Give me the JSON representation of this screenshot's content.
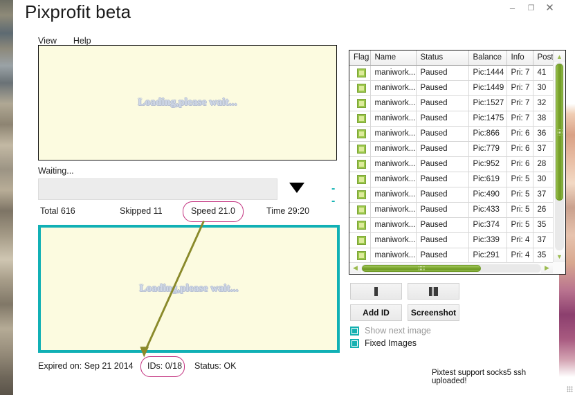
{
  "window": {
    "title": "Pixprofit beta",
    "controls": {
      "minimize": "–",
      "maximize": "❐",
      "close": "✕"
    }
  },
  "menubar": {
    "items": [
      {
        "label": "View"
      },
      {
        "label": "Help"
      }
    ]
  },
  "preview_top": {
    "loading_text": "Loading,please wait..."
  },
  "preview_bottom": {
    "loading_text": "Loading,please wait..."
  },
  "progress": {
    "waiting_label": "Waiting...",
    "value": "",
    "dropdown_icon": "triangle-down-icon",
    "dash_indicator": "--"
  },
  "stats": {
    "total": "Total 616",
    "skipped": "Skipped 11",
    "speed": "Speed 21.0",
    "time": "Time 29:20"
  },
  "footer": {
    "expired": "Expired on: Sep 21 2014",
    "ids": "IDs: 0/18",
    "status": "Status: OK",
    "support_note": "Pixtest support socks5  ssh uploaded!"
  },
  "annotations": {
    "highlight_color": "#c2307e",
    "arrow_color": "#8a8a2b",
    "speed_circled": "Speed 21.0",
    "ids_circled": "IDs: 0/18"
  },
  "accounts_table": {
    "columns": [
      "Flag",
      "Name",
      "Status",
      "Balance",
      "Info",
      "Poste"
    ],
    "rows": [
      {
        "flag": "flag-green-icon",
        "name": "maniwork...",
        "status": "Paused",
        "balance": "Pic:1444",
        "info": "Pri: 7",
        "posted": "41"
      },
      {
        "flag": "flag-green-icon",
        "name": "maniwork...",
        "status": "Paused",
        "balance": "Pic:1449",
        "info": "Pri: 7",
        "posted": "30"
      },
      {
        "flag": "flag-green-icon",
        "name": "maniwork...",
        "status": "Paused",
        "balance": "Pic:1527",
        "info": "Pri: 7",
        "posted": "32"
      },
      {
        "flag": "flag-green-icon",
        "name": "maniwork...",
        "status": "Paused",
        "balance": "Pic:1475",
        "info": "Pri: 7",
        "posted": "38"
      },
      {
        "flag": "flag-green-icon",
        "name": "maniwork...",
        "status": "Paused",
        "balance": "Pic:866",
        "info": "Pri: 6",
        "posted": "36"
      },
      {
        "flag": "flag-green-icon",
        "name": "maniwork...",
        "status": "Paused",
        "balance": "Pic:779",
        "info": "Pri: 6",
        "posted": "37"
      },
      {
        "flag": "flag-green-icon",
        "name": "maniwork...",
        "status": "Paused",
        "balance": "Pic:952",
        "info": "Pri: 6",
        "posted": "28"
      },
      {
        "flag": "flag-green-icon",
        "name": "maniwork...",
        "status": "Paused",
        "balance": "Pic:619",
        "info": "Pri: 5",
        "posted": "30"
      },
      {
        "flag": "flag-green-icon",
        "name": "maniwork...",
        "status": "Paused",
        "balance": "Pic:490",
        "info": "Pri: 5",
        "posted": "37"
      },
      {
        "flag": "flag-green-icon",
        "name": "maniwork...",
        "status": "Paused",
        "balance": "Pic:433",
        "info": "Pri: 5",
        "posted": "26"
      },
      {
        "flag": "flag-green-icon",
        "name": "maniwork...",
        "status": "Paused",
        "balance": "Pic:374",
        "info": "Pri: 5",
        "posted": "35"
      },
      {
        "flag": "flag-green-icon",
        "name": "maniwork...",
        "status": "Paused",
        "balance": "Pic:339",
        "info": "Pri: 4",
        "posted": "37"
      },
      {
        "flag": "flag-green-icon",
        "name": "maniwork...",
        "status": "Paused",
        "balance": "Pic:291",
        "info": "Pri: 4",
        "posted": "35"
      }
    ]
  },
  "controls": {
    "start_button": "stop-bar-icon",
    "pause_button": "pause-bars-icon",
    "add_id_label": "Add ID",
    "screenshot_label": "Screenshot",
    "checkboxes": [
      {
        "label": "Show next image",
        "checked": true,
        "disabled": true
      },
      {
        "label": "Fixed Images",
        "checked": true,
        "disabled": false
      }
    ]
  },
  "colors": {
    "teal_accent": "#11b0b5",
    "panel_cream": "#fcfbe0",
    "scrollbar_green": "#7ba42d",
    "annotation_magenta": "#c2307e"
  }
}
